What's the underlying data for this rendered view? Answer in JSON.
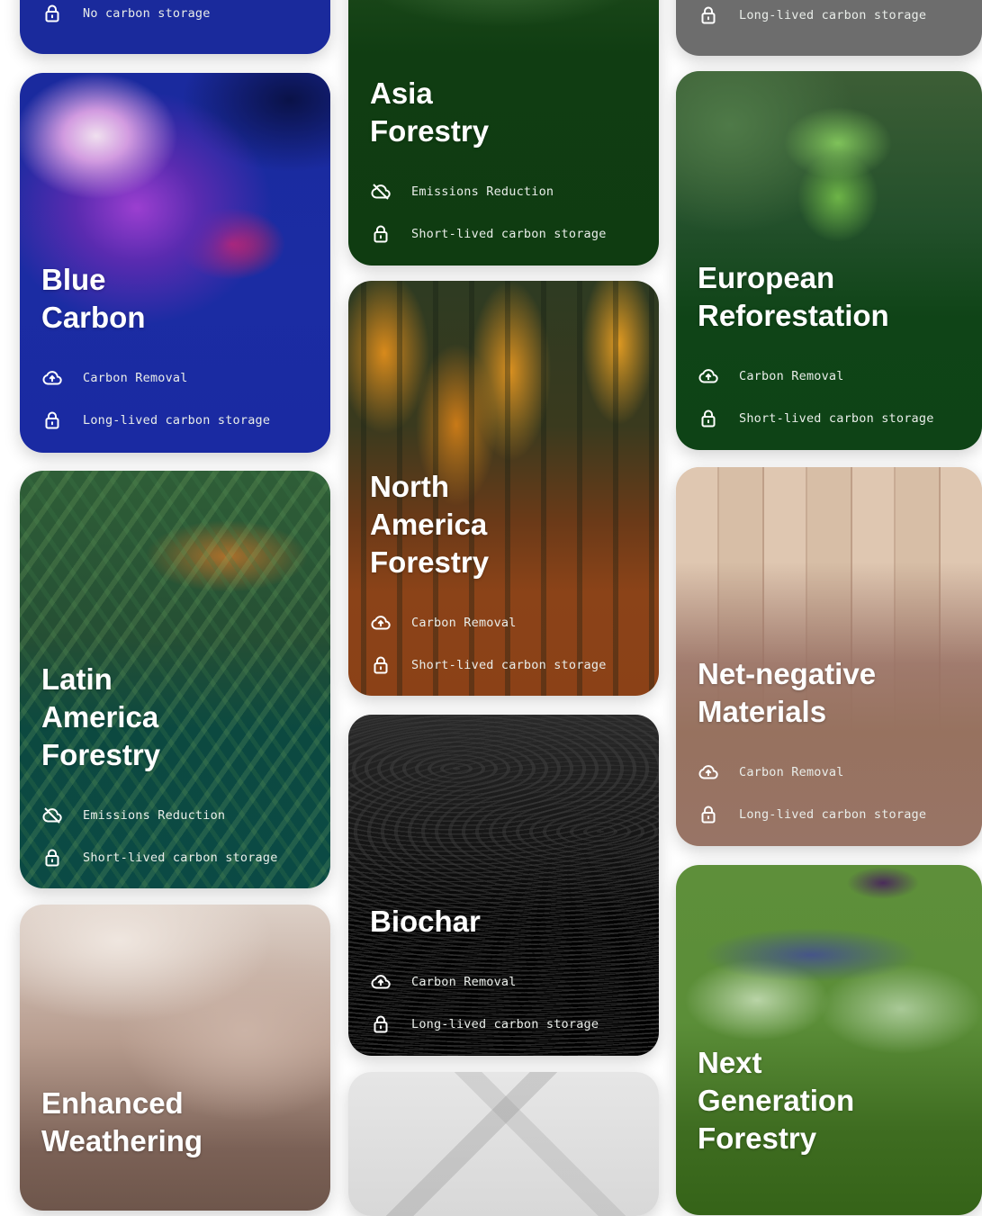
{
  "cards": {
    "blue_top": {
      "attr2": "No carbon storage"
    },
    "blue": {
      "title": "Blue\nCarbon",
      "attr1": "Carbon Removal",
      "attr2": "Long-lived carbon storage"
    },
    "latin": {
      "title": "Latin\nAmerica\nForestry",
      "attr1": "Emissions Reduction",
      "attr2": "Short-lived carbon storage"
    },
    "enhanced": {
      "title": "Enhanced\nWeathering"
    },
    "asia": {
      "title": "Asia\nForestry",
      "attr1": "Emissions Reduction",
      "attr2": "Short-lived carbon storage"
    },
    "na": {
      "title": "North\nAmerica\nForestry",
      "attr1": "Carbon Removal",
      "attr2": "Short-lived carbon storage"
    },
    "biochar": {
      "title": "Biochar",
      "attr1": "Carbon Removal",
      "attr2": "Long-lived carbon storage"
    },
    "grey_top": {
      "attr2": "Long-lived carbon storage"
    },
    "european": {
      "title": "European\nReforestation",
      "attr1": "Carbon Removal",
      "attr2": "Short-lived carbon storage"
    },
    "netneg": {
      "title": "Net-negative\nMaterials",
      "attr1": "Carbon Removal",
      "attr2": "Long-lived carbon storage"
    },
    "nextgen": {
      "title": "Next\nGeneration\nForestry"
    }
  },
  "icons": {
    "carbon_removal": "cloud-upload-icon",
    "emissions_reduction": "cloud-off-icon",
    "storage": "lock-icon"
  }
}
